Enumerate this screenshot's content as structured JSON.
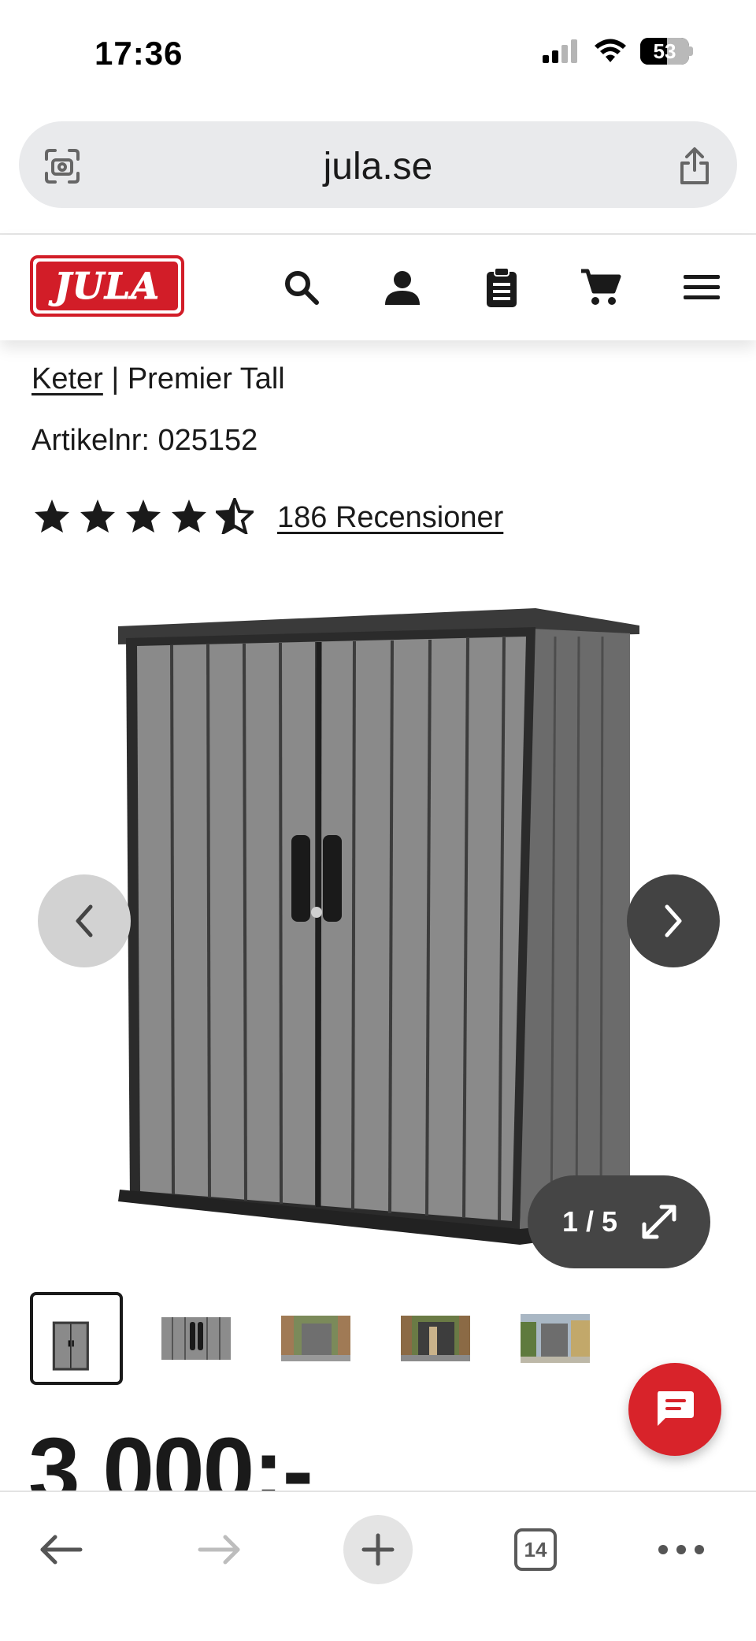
{
  "status_bar": {
    "time": "17:36",
    "battery": "53"
  },
  "browser": {
    "url": "jula.se",
    "tab_count": "14"
  },
  "site": {
    "logo_text": "JULA",
    "brand_color": "#d21d28"
  },
  "product": {
    "brand": "Keter",
    "separator": " | ",
    "name": "Premier Tall",
    "sku_label": "Artikelnr: ",
    "sku": "025152",
    "rating": 4.5,
    "reviews": "186 Recensioner",
    "image_counter": "1 / 5",
    "thumbnail_count": 5,
    "price": "3 000:-"
  },
  "icons": {
    "scan": "camera-scan-icon",
    "share": "share-icon",
    "search": "search-icon",
    "account": "person-icon",
    "list": "clipboard-icon",
    "cart": "cart-icon",
    "menu": "hamburger-menu-icon",
    "chat": "chat-icon"
  }
}
